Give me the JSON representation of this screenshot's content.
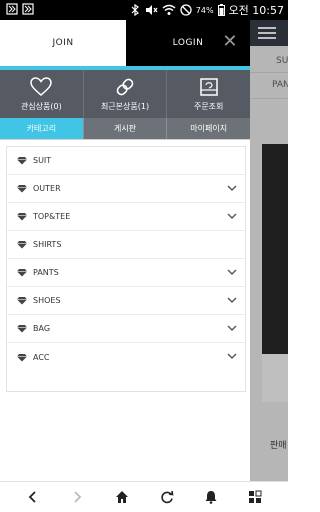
{
  "status_bar": {
    "battery": "74%",
    "time": "오전 10:57",
    "icons": [
      "notification-icon",
      "notification-icon",
      "bluetooth-icon",
      "mute-icon",
      "wifi-icon",
      "no-disturb-icon",
      "battery-icon"
    ]
  },
  "drawer": {
    "join_label": "JOIN",
    "login_label": "LOGIN",
    "close_glyph": "✕",
    "accent_color": "#41c5e6",
    "quick_links": [
      {
        "label": "관심상품(0)",
        "icon": "heart-icon"
      },
      {
        "label": "최근본상품(1)",
        "icon": "link-icon"
      },
      {
        "label": "주문조회",
        "icon": "order-box-icon"
      }
    ],
    "tabs": [
      {
        "label": "카테고리",
        "active": true
      },
      {
        "label": "게시판",
        "active": false
      },
      {
        "label": "마이페이지",
        "active": false
      }
    ],
    "categories": [
      {
        "label": "SUIT",
        "expandable": false
      },
      {
        "label": "OUTER",
        "expandable": true
      },
      {
        "label": "TOP&TEE",
        "expandable": true
      },
      {
        "label": "SHIRTS",
        "expandable": false
      },
      {
        "label": "PANTS",
        "expandable": true
      },
      {
        "label": "SHOES",
        "expandable": true
      },
      {
        "label": "BAG",
        "expandable": true
      },
      {
        "label": "ACC",
        "expandable": true
      }
    ]
  },
  "background_page": {
    "text1": "SU",
    "text2": "PAN",
    "bottom_text": "판매"
  },
  "bottom_nav": [
    "back-icon",
    "forward-icon",
    "home-icon",
    "refresh-icon",
    "bell-icon",
    "grid-icon"
  ]
}
